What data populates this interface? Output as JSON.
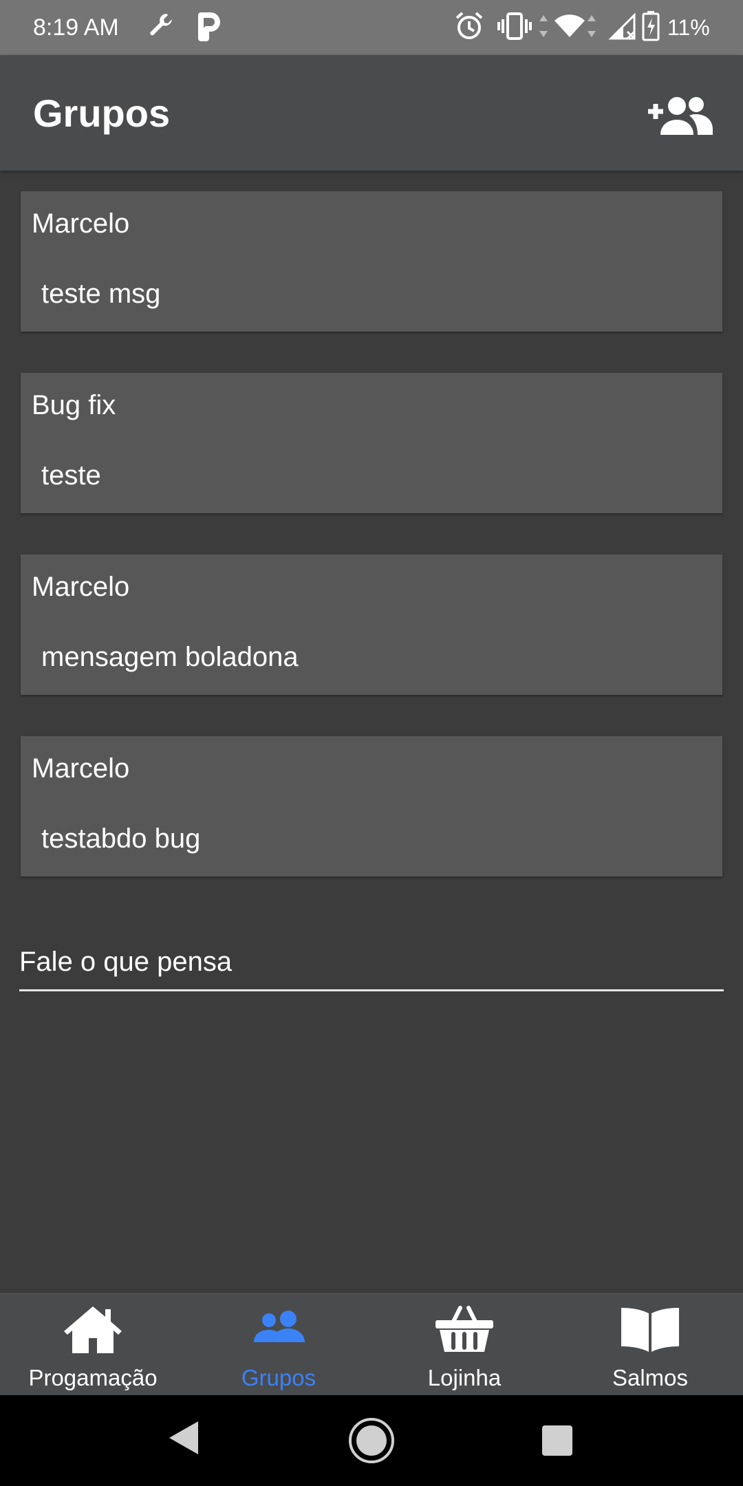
{
  "status_bar": {
    "time": "8:19 AM",
    "battery": "11%",
    "icons": [
      "wrench-icon",
      "parking-icon",
      "alarm-icon",
      "vibrate-icon",
      "wifi-icon",
      "signal-icon",
      "battery-charging-icon"
    ]
  },
  "app_bar": {
    "title": "Grupos",
    "action_icon": "add-group-icon"
  },
  "messages": [
    {
      "author": "Marcelo",
      "text": "teste msg"
    },
    {
      "author": "Bug fix",
      "text": "teste"
    },
    {
      "author": "Marcelo",
      "text": "mensagem boladona"
    },
    {
      "author": "Marcelo",
      "text": "testabdo bug"
    }
  ],
  "compose": {
    "placeholder": "Fale o que pensa",
    "value": ""
  },
  "bottom_nav": {
    "active_color": "#3b82f6",
    "items": [
      {
        "label": "Progamação",
        "icon": "home-icon",
        "active": false
      },
      {
        "label": "Grupos",
        "icon": "group-icon",
        "active": true
      },
      {
        "label": "Lojinha",
        "icon": "basket-icon",
        "active": false
      },
      {
        "label": "Salmos",
        "icon": "book-icon",
        "active": false
      }
    ]
  },
  "system_nav": {
    "icons": [
      "back-icon",
      "home-circle-icon",
      "recents-icon"
    ]
  }
}
